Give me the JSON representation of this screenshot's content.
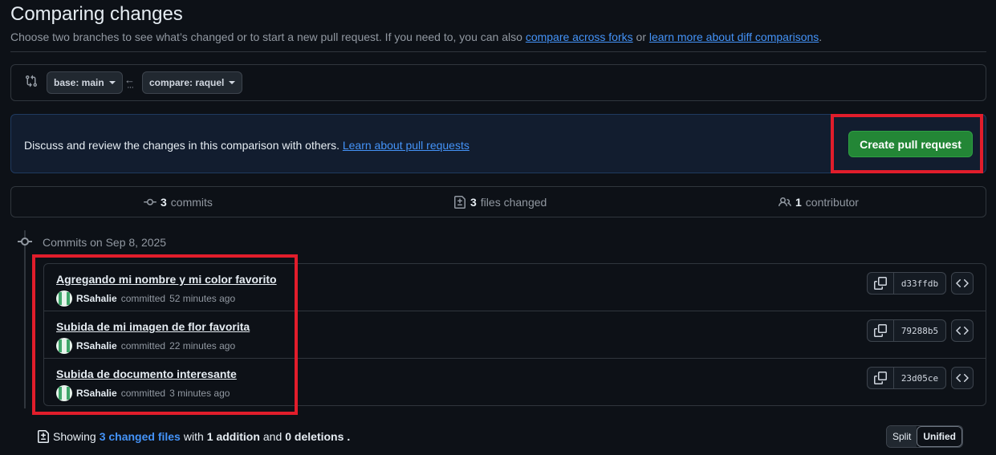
{
  "page": {
    "title": "Comparing changes",
    "subtitle_text": "Choose two branches to see what’s changed or to start a new pull request. If you need to, you can also",
    "subtitle_link1": "compare across forks",
    "subtitle_or": "or",
    "subtitle_link2": "learn more about diff comparisons",
    "subtitle_end": "."
  },
  "range": {
    "base_label": "base: main",
    "compare_label": "compare: raquel",
    "arrow": "←",
    "dots": "···"
  },
  "discuss": {
    "text": "Discuss and review the changes in this comparison with others.",
    "link": "Learn about pull requests",
    "button_label": "Create pull request"
  },
  "stats": {
    "commits_count": "3",
    "commits_label": "commits",
    "files_count": "3",
    "files_label": "files changed",
    "contributors_count": "1",
    "contributors_label": "contributor"
  },
  "commits": {
    "date_label": "Commits on Sep 8, 2025",
    "items": [
      {
        "message": "Agregando mi nombre y mi color favorito",
        "author": "RSahalie",
        "action": "committed",
        "time": "52 minutes ago",
        "sha": "d33ffdb"
      },
      {
        "message": "Subida de mi imagen de flor favorita",
        "author": "RSahalie",
        "action": "committed",
        "time": "22 minutes ago",
        "sha": "79288b5"
      },
      {
        "message": "Subida de documento interesante",
        "author": "RSahalie",
        "action": "committed",
        "time": "3 minutes ago",
        "sha": "23d05ce"
      }
    ]
  },
  "summary": {
    "showing": "Showing",
    "changed_files": "3 changed files",
    "with": "with",
    "additions": "1 addition",
    "and": "and",
    "deletions": "0 deletions",
    "end": ".",
    "split_label": "Split",
    "unified_label": "Unified"
  },
  "colors": {
    "accent": "#4493f8",
    "create_button": "#238636",
    "highlight": "#e11d2b",
    "background": "#0d1117"
  }
}
